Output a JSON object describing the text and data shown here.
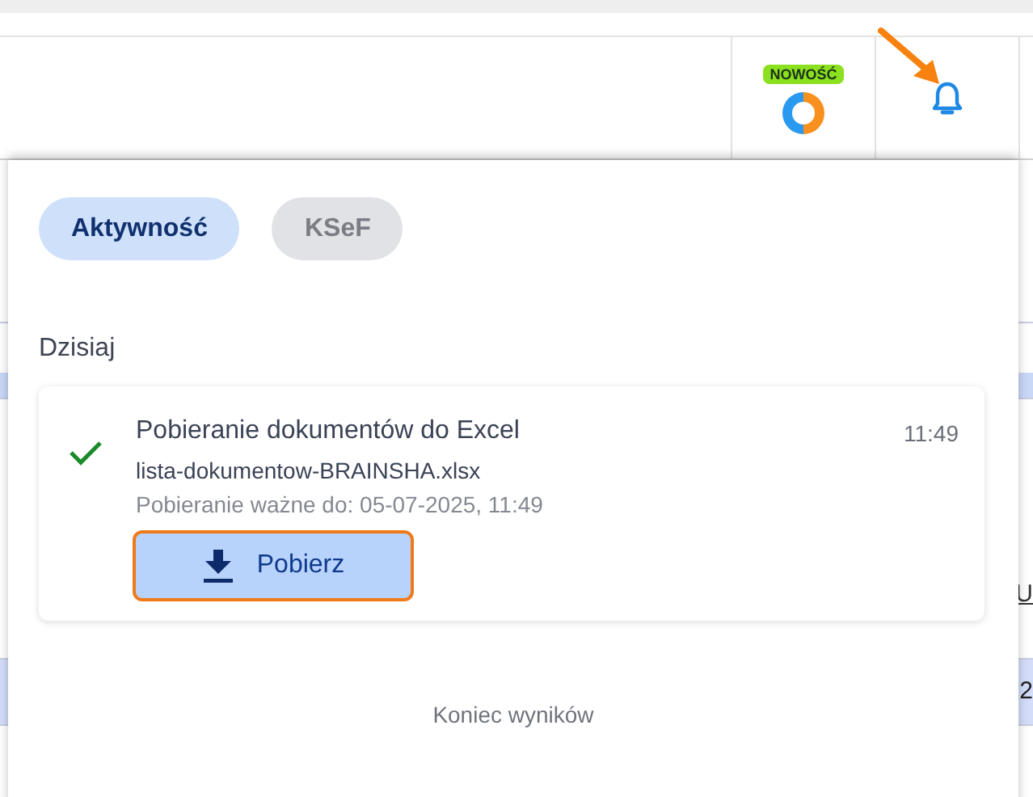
{
  "header": {
    "badge": "NOWOŚĆ"
  },
  "tabs": [
    {
      "label": "Aktywność",
      "selected": true
    },
    {
      "label": "KSeF",
      "selected": false
    }
  ],
  "section": "Dzisiaj",
  "notifications": [
    {
      "kind": "success",
      "title": "Pobieranie dokumentów do Excel",
      "time": "11:49",
      "file": "lista-dokumentow-BRAINSHA.xlsx",
      "expiry": "Pobieranie ważne do: 05-07-2025, 11:49",
      "action": "Pobierz"
    }
  ],
  "footer": "Koniec wyników",
  "background": {
    "right_link": "U",
    "right_cell": "2"
  }
}
